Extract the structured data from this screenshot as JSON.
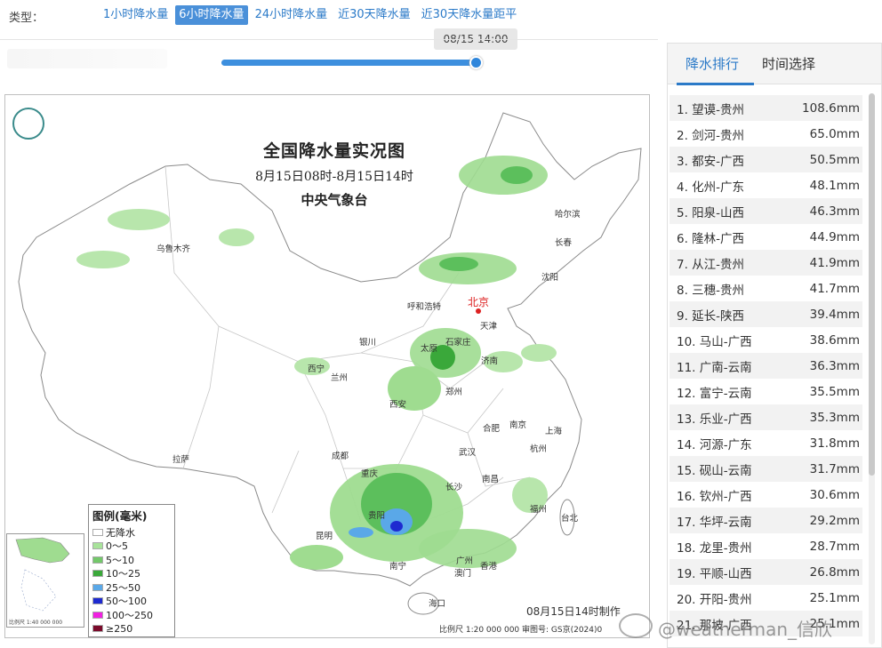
{
  "toolbar": {
    "type_label": "类型：",
    "tabs": [
      {
        "label": "1小时降水量",
        "active": false
      },
      {
        "label": "6小时降水量",
        "active": true
      },
      {
        "label": "24小时降水量",
        "active": false
      },
      {
        "label": "近30天降水量",
        "active": false
      },
      {
        "label": "近30天降水量距平",
        "active": false
      }
    ]
  },
  "slider": {
    "tooltip": "08/15 14:00",
    "progress": 1.0
  },
  "map": {
    "title": "全国降水量实况图",
    "subtitle": "8月15日08时-8月15日14时",
    "issuer": "中央气象台",
    "made_time": "08月15日14时制作",
    "scale_line": "比例尺 1:20 000 000    审图号: GS京(2024)0",
    "inset_scale": "比例尺 1:40 000 000",
    "legend": {
      "title": "图例(毫米)",
      "items": [
        {
          "label": "无降水",
          "color": "#ffffff"
        },
        {
          "label": "0～5",
          "color": "#a8e39a"
        },
        {
          "label": "5～10",
          "color": "#73c86a"
        },
        {
          "label": "10～25",
          "color": "#3aa83a"
        },
        {
          "label": "25～50",
          "color": "#5aa8e8"
        },
        {
          "label": "50～100",
          "color": "#1e2ad0"
        },
        {
          "label": "100～250",
          "color": "#f020e0"
        },
        {
          "label": "≥250",
          "color": "#7a0a2a"
        }
      ]
    },
    "cities": [
      "乌鲁木齐",
      "哈尔滨",
      "长春",
      "沈阳",
      "呼和浩特",
      "北京",
      "天津",
      "银川",
      "太原",
      "石家庄",
      "西宁",
      "兰州",
      "济南",
      "西安",
      "郑州",
      "合肥",
      "南京",
      "上海",
      "成都",
      "武汉",
      "杭州",
      "拉萨",
      "重庆",
      "长沙",
      "南昌",
      "福州",
      "贵阳",
      "台北",
      "昆明",
      "广州",
      "澳门",
      "香港",
      "南宁",
      "海口"
    ]
  },
  "panel": {
    "tabs": [
      {
        "label": "降水排行",
        "active": true
      },
      {
        "label": "时间选择",
        "active": false
      }
    ],
    "ranking": [
      {
        "name": "1. 望谟-贵州",
        "value": "108.6mm"
      },
      {
        "name": "2. 剑河-贵州",
        "value": "65.0mm"
      },
      {
        "name": "3. 都安-广西",
        "value": "50.5mm"
      },
      {
        "name": "4. 化州-广东",
        "value": "48.1mm"
      },
      {
        "name": "5. 阳泉-山西",
        "value": "46.3mm"
      },
      {
        "name": "6. 隆林-广西",
        "value": "44.9mm"
      },
      {
        "name": "7. 从江-贵州",
        "value": "41.9mm"
      },
      {
        "name": "8. 三穗-贵州",
        "value": "41.7mm"
      },
      {
        "name": "9. 延长-陕西",
        "value": "39.4mm"
      },
      {
        "name": "10. 马山-广西",
        "value": "38.6mm"
      },
      {
        "name": "11. 广南-云南",
        "value": "36.3mm"
      },
      {
        "name": "12. 富宁-云南",
        "value": "35.5mm"
      },
      {
        "name": "13. 乐业-广西",
        "value": "35.3mm"
      },
      {
        "name": "14. 河源-广东",
        "value": "31.8mm"
      },
      {
        "name": "15. 砚山-云南",
        "value": "31.7mm"
      },
      {
        "name": "16. 钦州-广西",
        "value": "30.6mm"
      },
      {
        "name": "17. 华坪-云南",
        "value": "29.2mm"
      },
      {
        "name": "18. 龙里-贵州",
        "value": "28.7mm"
      },
      {
        "name": "19. 平顺-山西",
        "value": "26.8mm"
      },
      {
        "name": "20. 开阳-贵州",
        "value": "25.1mm"
      },
      {
        "name": "21. 那坡-广西",
        "value": "25.1mm"
      }
    ]
  },
  "watermark": "@weatherman_信欣"
}
